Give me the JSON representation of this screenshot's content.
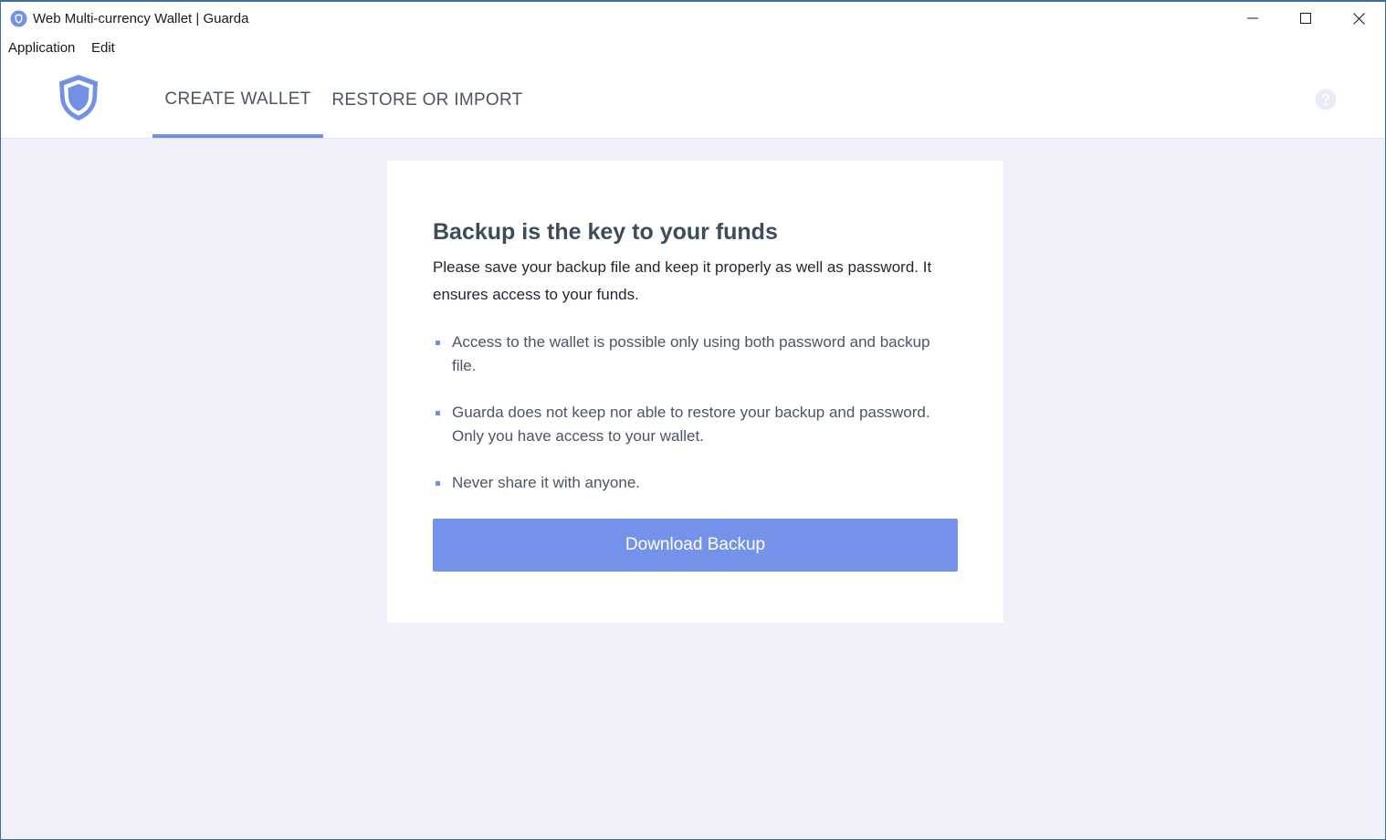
{
  "window": {
    "title": "Web Multi-currency Wallet | Guarda",
    "controls": [
      "minimize-icon",
      "maximize-icon",
      "close-icon"
    ]
  },
  "menubar": {
    "items": [
      {
        "label": "Application"
      },
      {
        "label": "Edit"
      }
    ]
  },
  "header": {
    "logo": "guarda-shield-icon",
    "tabs": [
      {
        "label": "CREATE WALLET",
        "active": true
      },
      {
        "label": "RESTORE OR IMPORT",
        "active": false
      }
    ],
    "help_icon": "question-mark-icon"
  },
  "card": {
    "title": "Backup is the key to your funds",
    "description": "Please save your backup file and keep it properly as well as password. It ensures access to your funds.",
    "bullets": [
      {
        "text": "Access to the wallet is possible only using both password and backup file."
      },
      {
        "text": "Guarda does not keep nor able to restore your backup and password. Only you have access to your wallet."
      },
      {
        "text": "Never share it with anyone."
      }
    ],
    "button_label": "Download Backup"
  },
  "colors": {
    "accent": "#7190e6",
    "button": "#7592ea",
    "background": "#f0f1f9",
    "heading": "#3d4b5a"
  }
}
